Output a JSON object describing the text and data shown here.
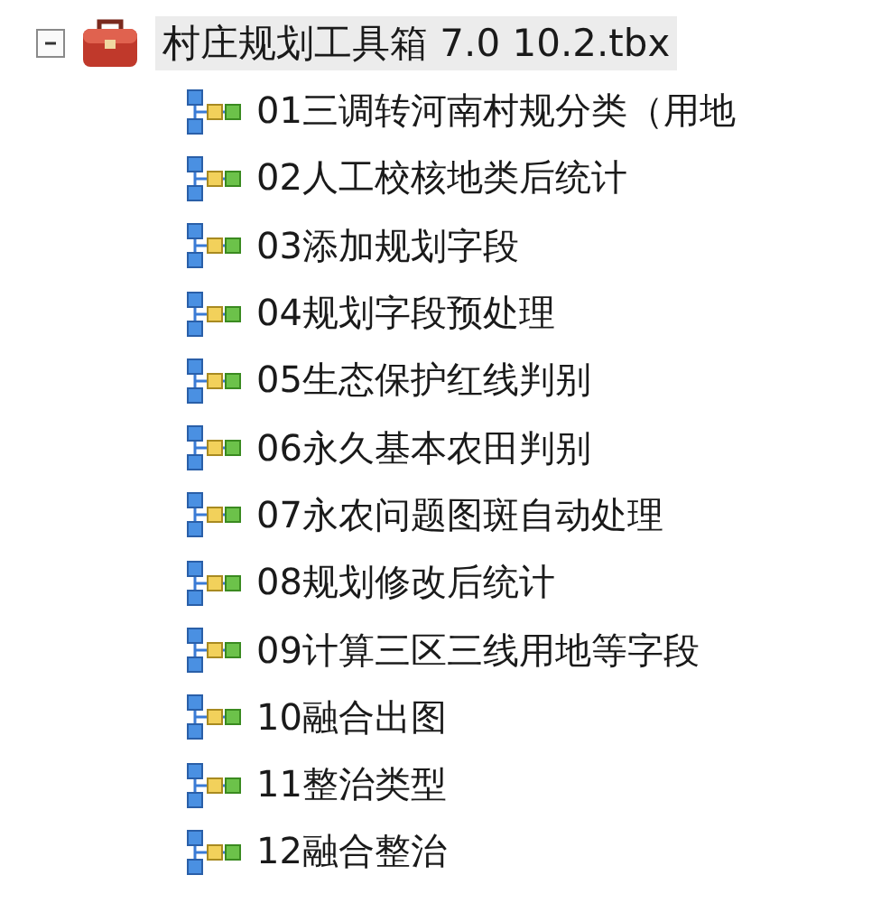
{
  "tree": {
    "label": "村庄规划工具箱 7.0 10.2.tbx",
    "expanded": true,
    "selected": true,
    "children": [
      {
        "label": "01三调转河南村规分类（用地",
        "selected": false
      },
      {
        "label": "02人工校核地类后统计",
        "selected": false
      },
      {
        "label": "03添加规划字段",
        "selected": false
      },
      {
        "label": "04规划字段预处理",
        "selected": false
      },
      {
        "label": "05生态保护红线判别",
        "selected": false
      },
      {
        "label": "06永久基本农田判别",
        "selected": false
      },
      {
        "label": "07永农问题图斑自动处理",
        "selected": false
      },
      {
        "label": "08规划修改后统计",
        "selected": false
      },
      {
        "label": "09计算三区三线用地等字段",
        "selected": false
      },
      {
        "label": "10融合出图",
        "selected": false
      },
      {
        "label": "11整治类型",
        "selected": false
      },
      {
        "label": "12融合整治",
        "selected": false
      }
    ]
  }
}
